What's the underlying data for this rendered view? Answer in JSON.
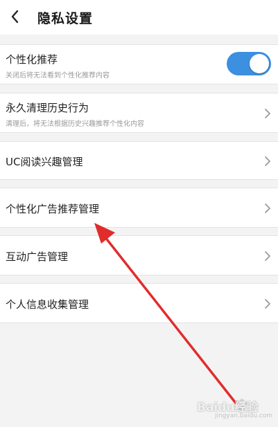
{
  "header": {
    "title": "隐私设置"
  },
  "items": [
    {
      "label": "个性化推荐",
      "sub": "关闭后将无法看到个性化推荐内容",
      "toggle": {
        "on": true,
        "color": "#3d8fe0"
      }
    },
    {
      "label": "永久清理历史行为",
      "sub": "清理后，将无法根据历史兴趣推荐个性化内容"
    },
    {
      "label": "UC阅读兴趣管理"
    },
    {
      "label": "个性化广告推荐管理"
    },
    {
      "label": "互动广告管理"
    },
    {
      "label": "个人信息收集管理"
    }
  ],
  "annotation": {
    "arrow_color": "#e12c2c"
  },
  "watermark": {
    "text": "Baidu经验",
    "sub": "jingyan.baidu.com"
  }
}
